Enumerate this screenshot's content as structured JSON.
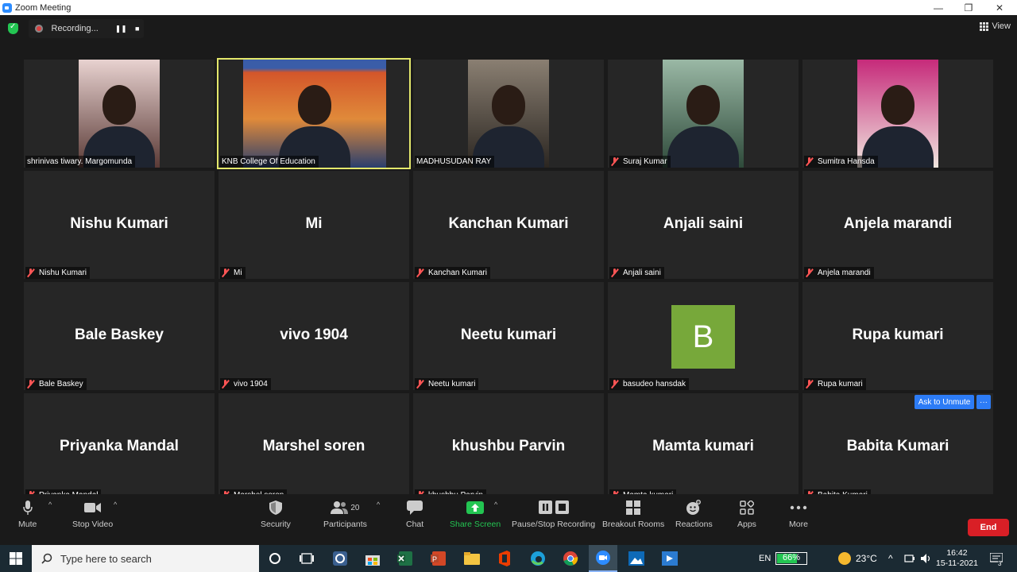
{
  "window": {
    "title": "Zoom Meeting",
    "minimize": "—",
    "restore": "❐",
    "close": "✕"
  },
  "recording": {
    "label": "Recording...",
    "pause": "❚❚",
    "stop": "■"
  },
  "view_label": "View",
  "participants": [
    {
      "name": "shrinivas tiwary. Margomunda",
      "video": true,
      "muted": false
    },
    {
      "name": "KNB College Of Education",
      "video": true,
      "muted": false,
      "active": true
    },
    {
      "name": "MADHUSUDAN RAY",
      "video": true,
      "muted": false
    },
    {
      "name": "Suraj Kumar",
      "video": true,
      "muted": true
    },
    {
      "name": "Sumitra Hansda",
      "video": true,
      "muted": true
    },
    {
      "name": "Nishu Kumari",
      "display": "Nishu Kumari",
      "muted": true
    },
    {
      "name": "Mi",
      "display": "Mi",
      "muted": true
    },
    {
      "name": "Kanchan Kumari",
      "display": "Kanchan Kumari",
      "muted": true
    },
    {
      "name": "Anjali saini",
      "display": "Anjali saini",
      "muted": true
    },
    {
      "name": "Anjela marandi",
      "display": "Anjela marandi",
      "muted": true
    },
    {
      "name": "Bale Baskey",
      "display": "Bale Baskey",
      "muted": true
    },
    {
      "name": "vivo 1904",
      "display": "vivo 1904",
      "muted": true
    },
    {
      "name": "Neetu kumari",
      "display": "Neetu kumari",
      "muted": true
    },
    {
      "name": "basudeo hansdak",
      "avatar": "B",
      "muted": true
    },
    {
      "name": "Rupa kumari",
      "display": "Rupa kumari",
      "muted": true
    },
    {
      "name": "Priyanka Mandal",
      "display": "Priyanka Mandal",
      "muted": true
    },
    {
      "name": "Marshel soren",
      "display": "Marshel soren",
      "muted": true
    },
    {
      "name": "khushbu Parvin",
      "display": "khushbu Parvin",
      "muted": true
    },
    {
      "name": "Mamta kumari",
      "display": "Mamta kumari",
      "muted": true
    },
    {
      "name": "Babita Kumari",
      "display": "Babita Kumari",
      "muted": true
    }
  ],
  "hover_actions": {
    "ask_to_unmute": "Ask to Unmute",
    "more": "···"
  },
  "toolbar": {
    "mute": "Mute",
    "stop_video": "Stop Video",
    "security": "Security",
    "participants": "Participants",
    "participants_count": "20",
    "chat": "Chat",
    "share_screen": "Share Screen",
    "pause_stop_recording": "Pause/Stop Recording",
    "breakout_rooms": "Breakout Rooms",
    "reactions": "Reactions",
    "apps": "Apps",
    "more": "More",
    "end": "End"
  },
  "taskbar": {
    "search_placeholder": "Type here to search",
    "language": "EN",
    "battery": "66%",
    "temperature": "23°C",
    "time": "16:42",
    "date": "15-11-2021",
    "notifications": "3"
  },
  "colors": {
    "accent": "#2d8cff",
    "active_speaker": "#e4e86b",
    "end": "#d91f26",
    "share": "#23c552",
    "mute_red": "#ff5555"
  }
}
